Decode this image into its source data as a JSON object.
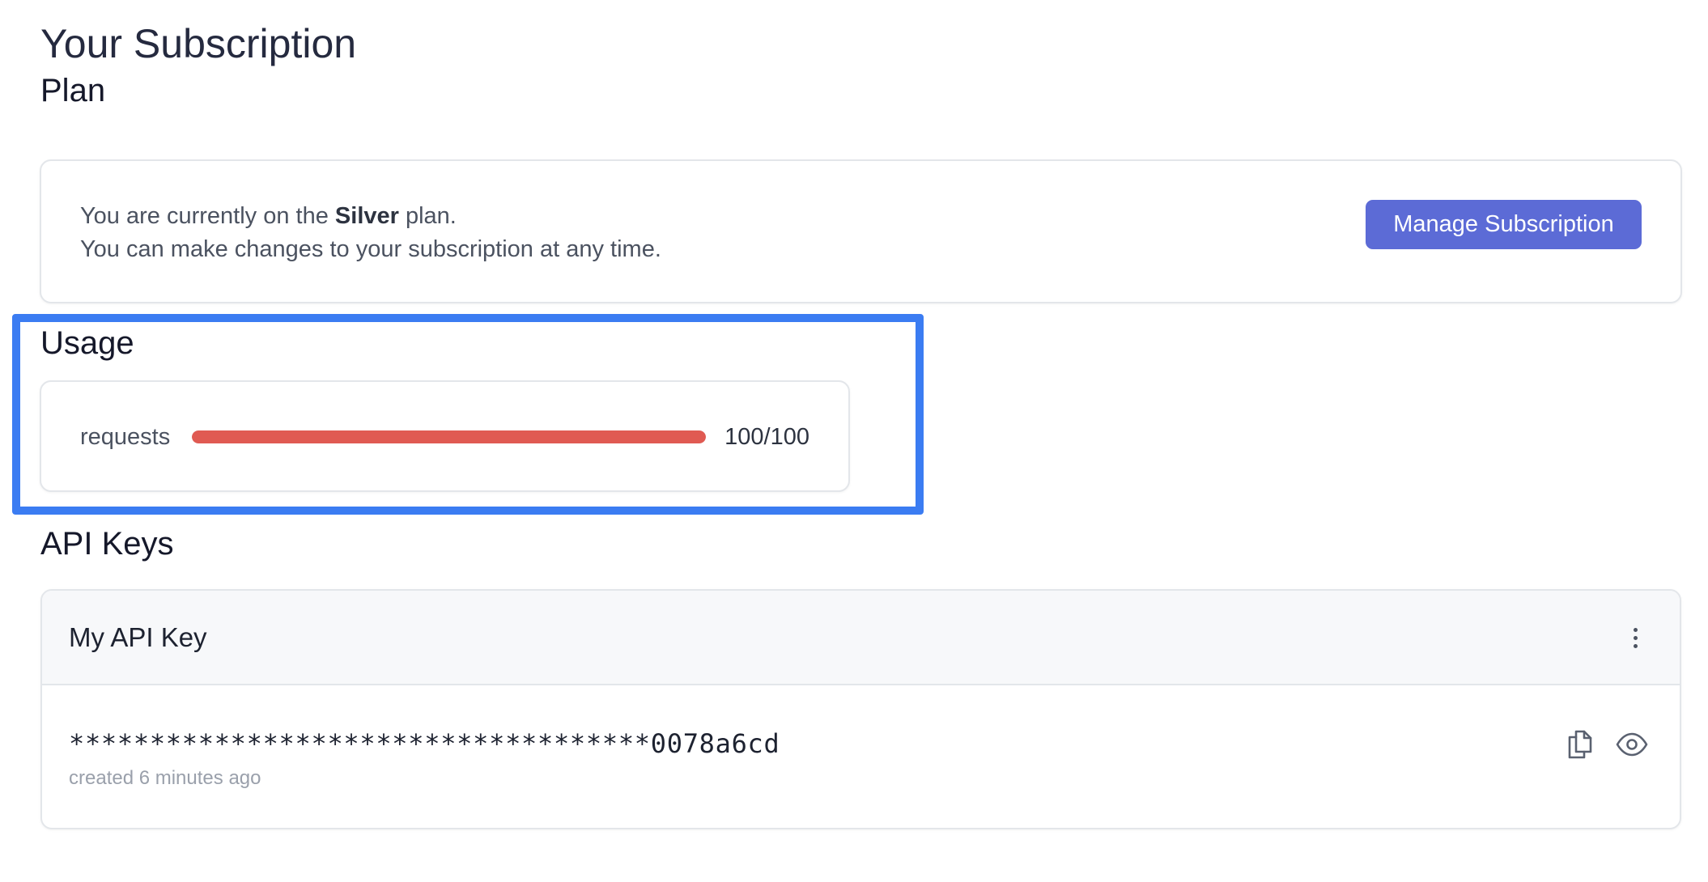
{
  "page": {
    "title": "Your Subscription"
  },
  "plan": {
    "heading": "Plan",
    "line1_prefix": "You are currently on the ",
    "plan_name": "Silver",
    "line1_suffix": " plan.",
    "line2": "You can make changes to your subscription at any time.",
    "manage_button_label": "Manage Subscription",
    "button_color": "#5c6bd6"
  },
  "usage": {
    "heading": "Usage",
    "metric_label": "requests",
    "used": 100,
    "limit": 100,
    "count_text": "100/100",
    "bar_color": "#e05a52",
    "highlight_color": "#3b7cf2"
  },
  "api_keys": {
    "heading": "API Keys",
    "items": [
      {
        "name": "My API Key",
        "masked_value": "************************************0078a6cd",
        "created": "created 6 minutes ago",
        "menu_icon": "more-vertical-icon",
        "copy_icon": "copy-icon",
        "view_icon": "eye-icon"
      }
    ]
  }
}
